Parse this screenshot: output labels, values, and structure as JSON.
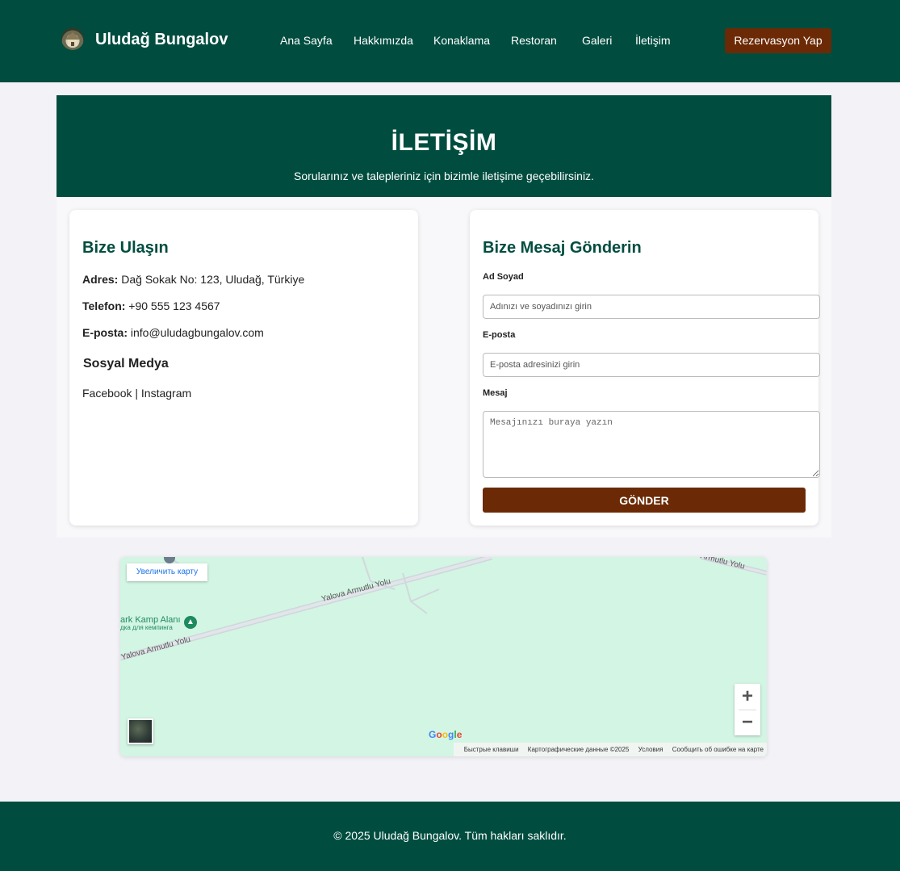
{
  "header": {
    "brand": "Uludağ Bungalov",
    "nav": [
      "Ana Sayfa",
      "Hakkımızda",
      "Konaklama",
      "Restoran",
      "Galeri",
      "İletişim"
    ],
    "cta": "Rezervasyon Yap"
  },
  "hero": {
    "title": "İLETİŞİM",
    "subtitle": "Sorularınız ve talepleriniz için bizimle iletişime geçebilirsiniz."
  },
  "contact": {
    "title": "Bize Ulaşın",
    "address_label": "Adres:",
    "address": "Dağ Sokak No: 123, Uludağ, Türkiye",
    "phone_label": "Telefon:",
    "phone": "+90 555 123 4567",
    "email_label": "E-posta:",
    "email": "info@uludagbungalov.com",
    "social_title": "Sosyal Medya",
    "social_facebook": "Facebook",
    "social_separator": "|",
    "social_instagram": "Instagram"
  },
  "form": {
    "title": "Bize Mesaj Gönderin",
    "name_label": "Ad Soyad",
    "name_placeholder": "Adınızı ve soyadınızı girin",
    "email_label": "E-posta",
    "email_placeholder": "E-posta adresinizi girin",
    "message_label": "Mesaj",
    "message_placeholder": "Mesajınızı buraya yazın",
    "submit": "GÖNDER"
  },
  "map": {
    "enlarge": "Увеличить карту",
    "road_1": "Yalova Armutlu Yolu",
    "road_2": "Yalova Armutlu Yolu",
    "road_3": "Armutlu Yolu",
    "camp_name": "ark Kamp Alanı",
    "camp_sub": "дка для кемпинга",
    "zoom_in": "+",
    "zoom_out": "−",
    "google": "Google",
    "attribution": [
      "Быстрые клавиши",
      "Картографические данные ©2025",
      "Условия",
      "Сообщить об ошибке на карте"
    ]
  },
  "footer": {
    "copyright": "© 2025 Uludağ Bungalov. Tüm hakları saklıdır."
  },
  "colors": {
    "primary": "#004d40",
    "accent": "#6b2a05",
    "background": "#f3f3f7"
  }
}
